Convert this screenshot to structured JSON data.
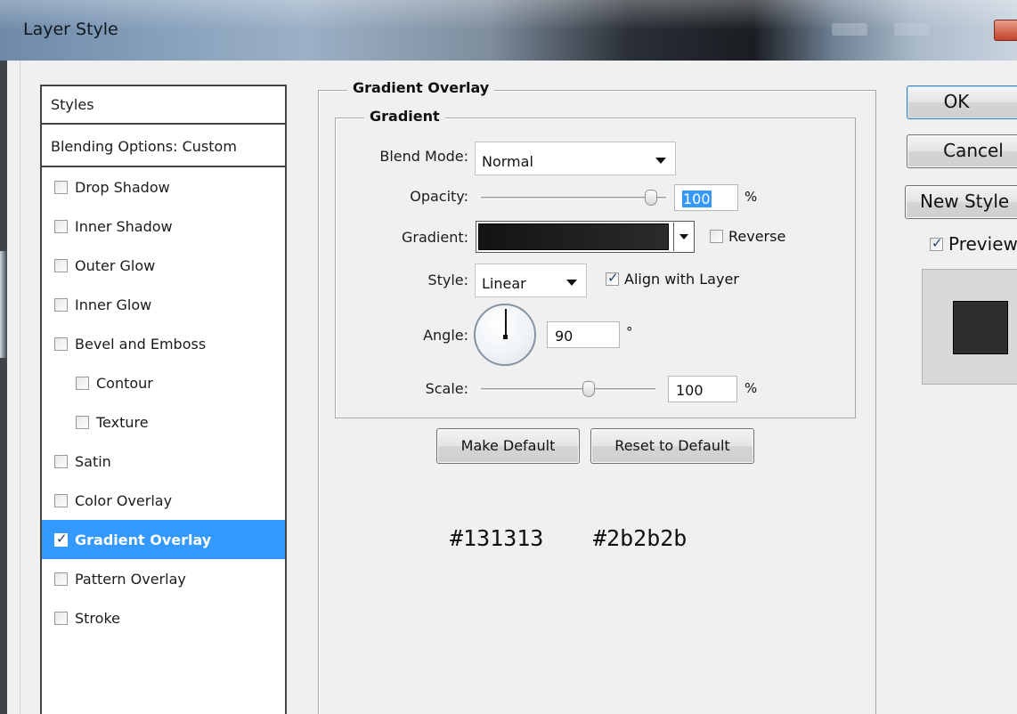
{
  "window": {
    "title": "Layer Style"
  },
  "styles_panel": {
    "header": "Styles",
    "blending": "Blending Options: Custom",
    "items": [
      {
        "label": "Drop Shadow",
        "checked": false,
        "indent": false,
        "selected": false
      },
      {
        "label": "Inner Shadow",
        "checked": false,
        "indent": false,
        "selected": false
      },
      {
        "label": "Outer Glow",
        "checked": false,
        "indent": false,
        "selected": false
      },
      {
        "label": "Inner Glow",
        "checked": false,
        "indent": false,
        "selected": false
      },
      {
        "label": "Bevel and Emboss",
        "checked": false,
        "indent": false,
        "selected": false
      },
      {
        "label": "Contour",
        "checked": false,
        "indent": true,
        "selected": false
      },
      {
        "label": "Texture",
        "checked": false,
        "indent": true,
        "selected": false
      },
      {
        "label": "Satin",
        "checked": false,
        "indent": false,
        "selected": false
      },
      {
        "label": "Color Overlay",
        "checked": false,
        "indent": false,
        "selected": false
      },
      {
        "label": "Gradient Overlay",
        "checked": true,
        "indent": false,
        "selected": true
      },
      {
        "label": "Pattern Overlay",
        "checked": false,
        "indent": false,
        "selected": false
      },
      {
        "label": "Stroke",
        "checked": false,
        "indent": false,
        "selected": false
      }
    ]
  },
  "gradient_overlay": {
    "section_title": "Gradient Overlay",
    "group_title": "Gradient",
    "blend_mode": {
      "label": "Blend Mode:",
      "value": "Normal"
    },
    "opacity": {
      "label": "Opacity:",
      "value": "100",
      "unit": "%",
      "level": 1.0
    },
    "gradient": {
      "label": "Gradient:",
      "color_start": "#131313",
      "color_end": "#2b2b2b",
      "reverse_label": "Reverse",
      "reverse_checked": false
    },
    "style": {
      "label": "Style:",
      "value": "Linear",
      "align_label": "Align with Layer",
      "align_checked": true
    },
    "angle": {
      "label": "Angle:",
      "value": "90",
      "unit": "°"
    },
    "scale": {
      "label": "Scale:",
      "value": "100",
      "unit": "%"
    },
    "buttons": {
      "make_default": "Make Default",
      "reset_default": "Reset to Default"
    },
    "hex_start": "#131313",
    "hex_end": "#2b2b2b"
  },
  "actions": {
    "ok": "OK",
    "cancel": "Cancel",
    "new_style": "New Style",
    "preview_label": "Preview",
    "preview_checked": true,
    "preview_swatch_color": "#2d2d2d"
  }
}
